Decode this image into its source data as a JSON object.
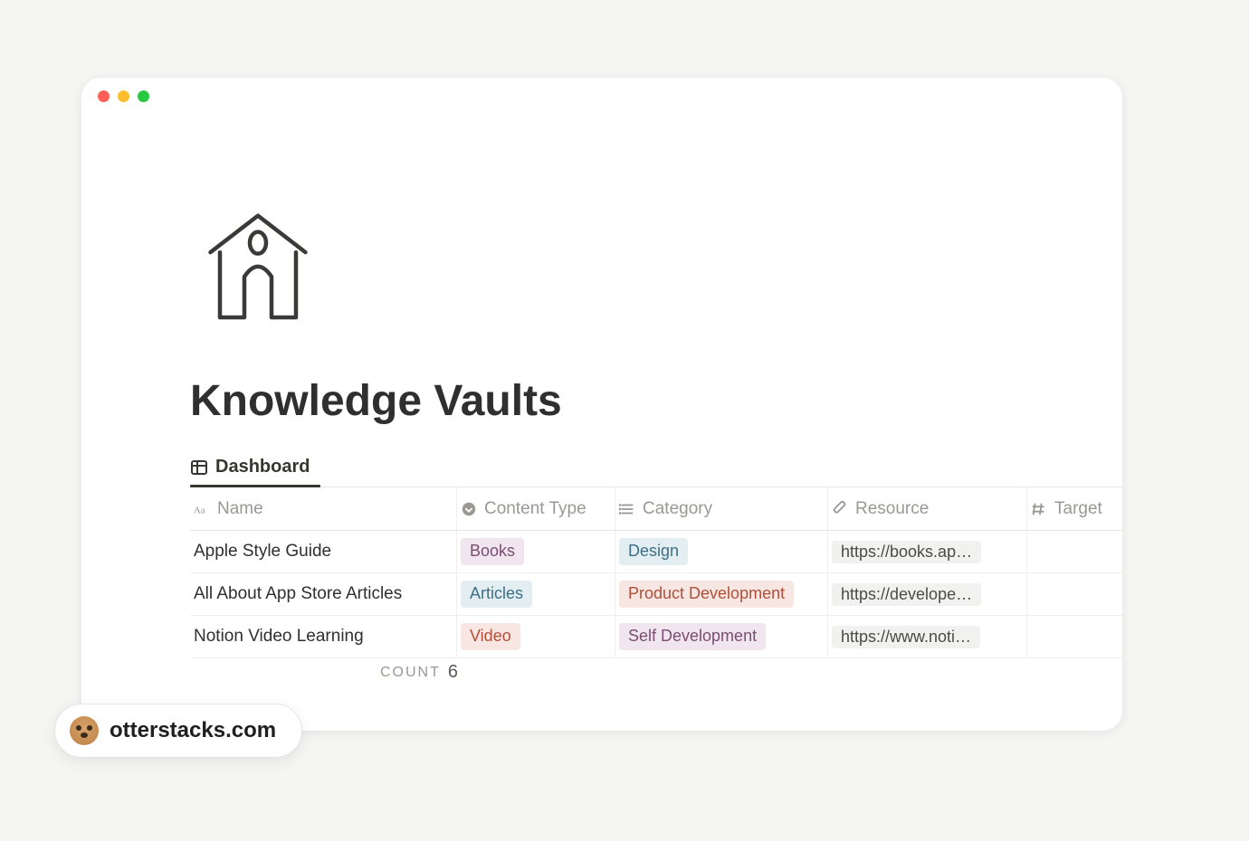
{
  "page": {
    "title": "Knowledge Vaults",
    "tab_label": "Dashboard"
  },
  "columns": {
    "name": "Name",
    "content_type": "Content Type",
    "category": "Category",
    "resource": "Resource",
    "target": "Target"
  },
  "rows": [
    {
      "name": "Apple Style Guide",
      "content_type": {
        "label": "Books",
        "bg": "#f1e6ef",
        "fg": "#7a4d72"
      },
      "category": {
        "label": "Design",
        "bg": "#e3eef3",
        "fg": "#3e6f84"
      },
      "resource": "https://books.ap…"
    },
    {
      "name": "All About App Store Articles",
      "content_type": {
        "label": "Articles",
        "bg": "#e3eef3",
        "fg": "#3e6f84"
      },
      "category": {
        "label": "Product Development",
        "bg": "#f7e6e1",
        "fg": "#b04f3a"
      },
      "resource": "https://develope…"
    },
    {
      "name": "Notion Video Learning",
      "content_type": {
        "label": "Video",
        "bg": "#f7e6e1",
        "fg": "#b04f3a"
      },
      "category": {
        "label": "Self Development",
        "bg": "#f1e6ef",
        "fg": "#7a4d72"
      },
      "resource": "https://www.noti…"
    }
  ],
  "footer": {
    "count_label": "COUNT",
    "count_value": "6"
  },
  "watermark": {
    "text": "otterstacks.com"
  }
}
